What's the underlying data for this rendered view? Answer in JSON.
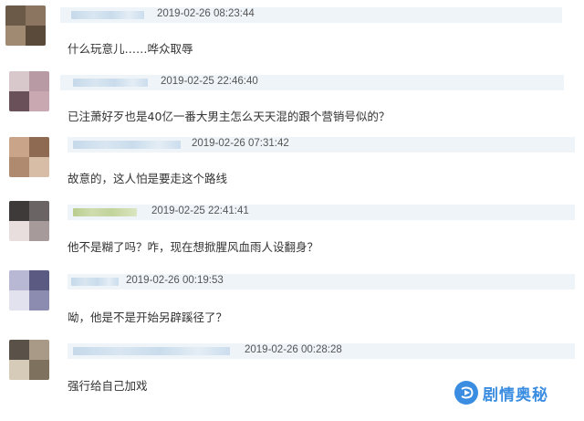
{
  "comments": [
    {
      "timestamp": "2019-02-26 08:23:44",
      "text": "什么玩意儿……哗众取辱"
    },
    {
      "timestamp": "2019-02-25 22:46:40",
      "text": "已注萧好歹也是40亿一番大男主怎么天天混的跟个营销号似的？"
    },
    {
      "timestamp": "2019-02-26 07:31:42",
      "text": "故意的，这人怕是要走这个路线"
    },
    {
      "timestamp": "2019-02-25 22:41:41",
      "text": "他不是糊了吗？咋，现在想掀腥风血雨人设翻身？"
    },
    {
      "timestamp": "2019-02-26 00:19:53",
      "text": "呦，他是不是开始另辟蹊径了？"
    },
    {
      "timestamp": "2019-02-26 00:28:28",
      "text": "强行给自己加戏"
    }
  ],
  "watermark": {
    "text": "剧情奥秘",
    "icon": "play-bubble-icon",
    "color": "#3a8de0"
  }
}
